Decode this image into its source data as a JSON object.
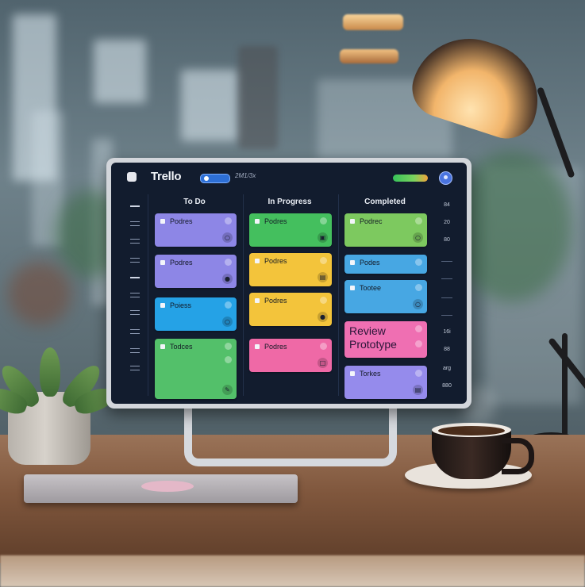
{
  "app": {
    "title": "Trello",
    "topbar_text": "2M1/3x"
  },
  "board": {
    "columns": [
      {
        "title": "To Do"
      },
      {
        "title": "In Progress"
      },
      {
        "title": "Completed"
      }
    ],
    "todo": [
      {
        "label": "Podres",
        "color": "#8d86e6",
        "icon": "lock-icon"
      },
      {
        "label": "Podres",
        "color": "#8d86e6",
        "icon": "person-icon"
      },
      {
        "label": "Poiess",
        "color": "#25a2e6",
        "icon": "lock-icon"
      },
      {
        "label": "Todces",
        "color": "#53c06a",
        "icon": "edit-icon"
      }
    ],
    "in_progress": [
      {
        "label": "Podres",
        "color": "#44bf5e",
        "icon": "box-icon"
      },
      {
        "label": "Podres",
        "color": "#f3c43b",
        "icon": "copy-icon"
      },
      {
        "label": "Podres",
        "color": "#f3c43b",
        "icon": "bulb-icon"
      },
      {
        "label": "Podres",
        "color": "#ef69a6",
        "icon": "calendar-icon"
      }
    ],
    "completed": [
      {
        "label": "Podrec",
        "color": "#7dc95f",
        "icon": "lock-icon"
      },
      {
        "label": "Podes",
        "color": "#47a7e3",
        "icon": ""
      },
      {
        "label": "Tootee",
        "color": "#47a7e3",
        "icon": "lock-icon"
      },
      {
        "label": "Review Prototype",
        "color": "#ef6fb2",
        "icon": ""
      },
      {
        "label": "Torkes",
        "color": "#958bec",
        "icon": "clipboard-icon"
      }
    ]
  },
  "right_rail": [
    "84",
    "20",
    "80",
    "",
    "",
    "",
    "",
    "16i",
    "88",
    "arg",
    "880"
  ]
}
